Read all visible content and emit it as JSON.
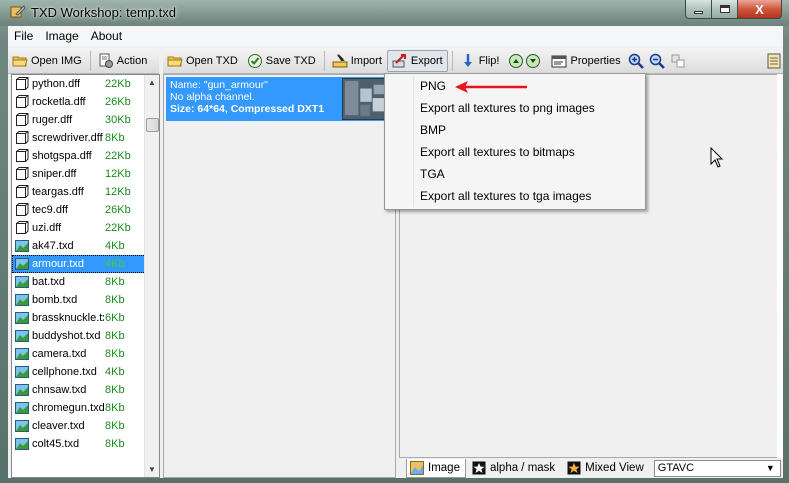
{
  "window": {
    "title": "TXD Workshop: temp.txd",
    "close_glyph": "X"
  },
  "menu": {
    "items": [
      {
        "label": "File",
        "name": "menu-file"
      },
      {
        "label": "Image",
        "name": "menu-image"
      },
      {
        "label": "About",
        "name": "menu-about"
      }
    ]
  },
  "toolbar_left": {
    "open_img": "Open IMG",
    "action": "Action"
  },
  "toolbar_main": {
    "open_txd": "Open TXD",
    "save_txd": "Save TXD",
    "import": "Import",
    "export": "Export",
    "flip": "Flip!",
    "properties": "Properties"
  },
  "files": [
    {
      "name": "python.dff",
      "size": "22Kb",
      "type": "dff"
    },
    {
      "name": "rocketla.dff",
      "size": "26Kb",
      "type": "dff"
    },
    {
      "name": "ruger.dff",
      "size": "30Kb",
      "type": "dff"
    },
    {
      "name": "screwdriver.dff",
      "size": "8Kb",
      "type": "dff"
    },
    {
      "name": "shotgspa.dff",
      "size": "22Kb",
      "type": "dff"
    },
    {
      "name": "sniper.dff",
      "size": "12Kb",
      "type": "dff"
    },
    {
      "name": "teargas.dff",
      "size": "12Kb",
      "type": "dff"
    },
    {
      "name": "tec9.dff",
      "size": "26Kb",
      "type": "dff"
    },
    {
      "name": "uzi.dff",
      "size": "22Kb",
      "type": "dff"
    },
    {
      "name": "ak47.txd",
      "size": "4Kb",
      "type": "txd"
    },
    {
      "name": "armour.txd",
      "size": "4Kb",
      "type": "txd",
      "selected": true
    },
    {
      "name": "bat.txd",
      "size": "8Kb",
      "type": "txd"
    },
    {
      "name": "bomb.txd",
      "size": "8Kb",
      "type": "txd"
    },
    {
      "name": "brassknuckle.txd",
      "size": "6Kb",
      "type": "txd"
    },
    {
      "name": "buddyshot.txd",
      "size": "8Kb",
      "type": "txd"
    },
    {
      "name": "camera.txd",
      "size": "8Kb",
      "type": "txd"
    },
    {
      "name": "cellphone.txd",
      "size": "4Kb",
      "type": "txd"
    },
    {
      "name": "chnsaw.txd",
      "size": "8Kb",
      "type": "txd"
    },
    {
      "name": "chromegun.txd",
      "size": "8Kb",
      "type": "txd"
    },
    {
      "name": "cleaver.txd",
      "size": "8Kb",
      "type": "txd"
    },
    {
      "name": "colt45.txd",
      "size": "8Kb",
      "type": "txd"
    }
  ],
  "texture": {
    "name_line": "Name: \"gun_armour\"",
    "alpha_line": "No alpha channel.",
    "size_line": "Size: 64*64, Compressed DXT1"
  },
  "export_menu": {
    "items": [
      {
        "label": "PNG",
        "name": "export-png"
      },
      {
        "label": "Export all textures to png images",
        "name": "export-all-png"
      },
      {
        "label": "BMP",
        "name": "export-bmp"
      },
      {
        "label": "Export all textures to bitmaps",
        "name": "export-all-bmp"
      },
      {
        "label": "TGA",
        "name": "export-tga"
      },
      {
        "label": "Export all textures to tga images",
        "name": "export-all-tga"
      }
    ]
  },
  "bottom": {
    "tabs": [
      {
        "label": "Image",
        "name": "tab-image",
        "active": true
      },
      {
        "label": "alpha / mask",
        "name": "tab-alpha-mask"
      },
      {
        "label": "Mixed View",
        "name": "tab-mixed-view"
      }
    ],
    "platform_select": "GTAVC"
  },
  "colors": {
    "selection": "#3399ff",
    "size_text": "#1a8a1a",
    "arrow": "#e8141e"
  }
}
